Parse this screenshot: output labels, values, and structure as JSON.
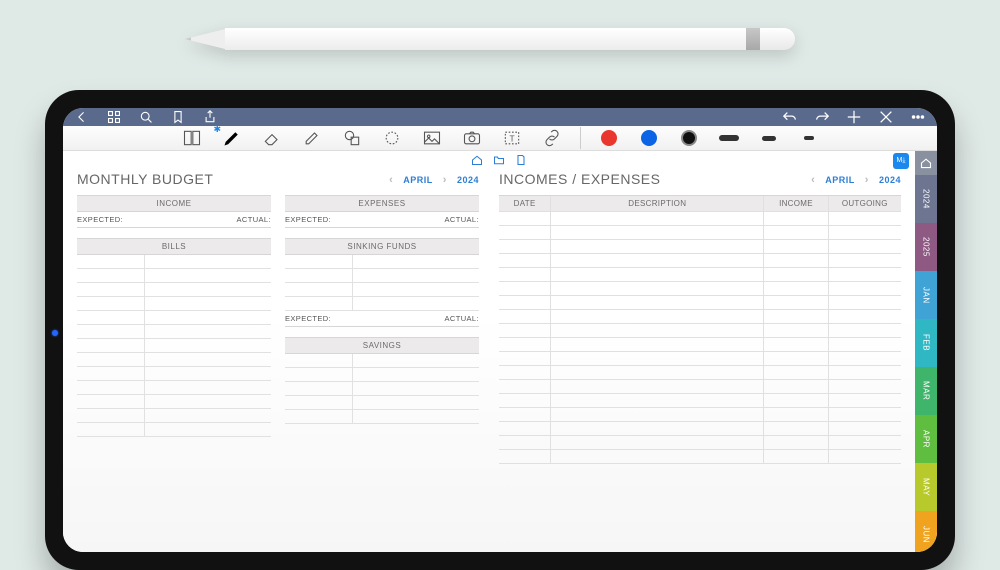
{
  "pencil": {
    "name": "apple-pencil"
  },
  "topbar": {
    "icons": [
      "back",
      "apps",
      "search",
      "bookmark",
      "share"
    ],
    "right_icons": [
      "undo",
      "redo",
      "add",
      "close",
      "more"
    ]
  },
  "toolrow": {
    "tools": [
      "page-layout",
      "pen",
      "eraser",
      "highlighter",
      "shapes",
      "lasso",
      "image",
      "camera",
      "text",
      "link"
    ],
    "colors": [
      "red",
      "blue",
      "black",
      "grey"
    ],
    "strokes": [
      "wide",
      "mid",
      "thin"
    ]
  },
  "page_tabs": [
    "home",
    "folder",
    "document"
  ],
  "badge": "M⤓",
  "left_page": {
    "title": "MONTHLY BUDGET",
    "month": "APRIL",
    "year": "2024",
    "income_head": "INCOME",
    "expenses_head": "EXPENSES",
    "bills_head": "BILLS",
    "sinking_head": "SINKING FUNDS",
    "savings_head": "SAVINGS",
    "expected_label": "EXPECTED:",
    "actual_label": "ACTUAL:"
  },
  "right_page": {
    "title": "INCOMES / EXPENSES",
    "month": "APRIL",
    "year": "2024",
    "col_date": "DATE",
    "col_desc": "DESCRIPTION",
    "col_income": "INCOME",
    "col_outgoing": "OUTGOING"
  },
  "sidetabs": [
    {
      "label": "",
      "color": "#89909f",
      "home": true
    },
    {
      "label": "2024",
      "color": "#6e7590"
    },
    {
      "label": "2025",
      "color": "#8e5a83"
    },
    {
      "label": "JAN",
      "color": "#3fa3d6"
    },
    {
      "label": "FEB",
      "color": "#2fb8c4"
    },
    {
      "label": "MAR",
      "color": "#3fb56c"
    },
    {
      "label": "APR",
      "color": "#5fbd3f"
    },
    {
      "label": "MAY",
      "color": "#b8c92b"
    },
    {
      "label": "JUN",
      "color": "#f0a31f"
    }
  ]
}
